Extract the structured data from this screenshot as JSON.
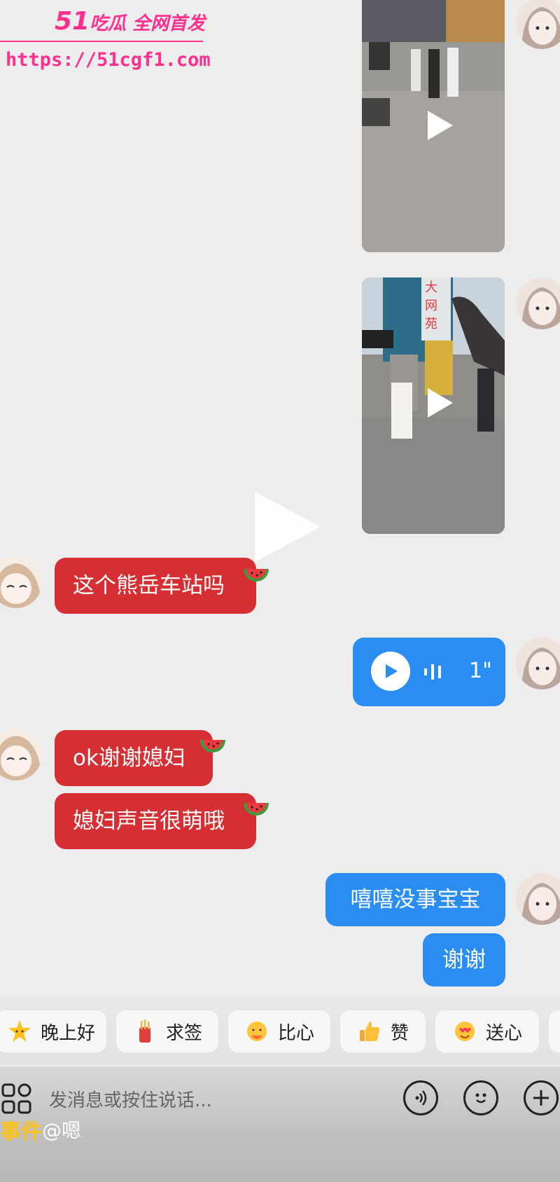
{
  "watermark": {
    "brand_num": "51",
    "brand_text": "吃瓜 全网首发",
    "url": "https://51cgf1.com"
  },
  "messages": {
    "msg1": "这个熊岳车站吗",
    "voice_duration": "1\"",
    "msg2": "ok谢谢媳妇",
    "msg3": "媳妇声音很萌哦",
    "msg4": "嘻嘻没事宝宝",
    "msg5": "谢谢"
  },
  "media": {
    "sign_text": "大网苑"
  },
  "quick_replies": [
    "晚上好",
    "求签",
    "比心",
    "赞",
    "送心"
  ],
  "input": {
    "placeholder": "发消息或按住说话..."
  },
  "footer": {
    "tag": "事件",
    "mention": "@嗯"
  },
  "icons": {
    "apps": "apps-grid-icon",
    "voice": "voice-wave-icon",
    "emoji": "emoji-icon",
    "plus": "plus-icon",
    "watermelon": "watermelon-icon",
    "play": "play-icon"
  },
  "colors": {
    "red_bubble": "#d62f33",
    "blue_bubble": "#2a8df2",
    "watermark": "#ff2f8d",
    "tag": "#ffc21a"
  }
}
